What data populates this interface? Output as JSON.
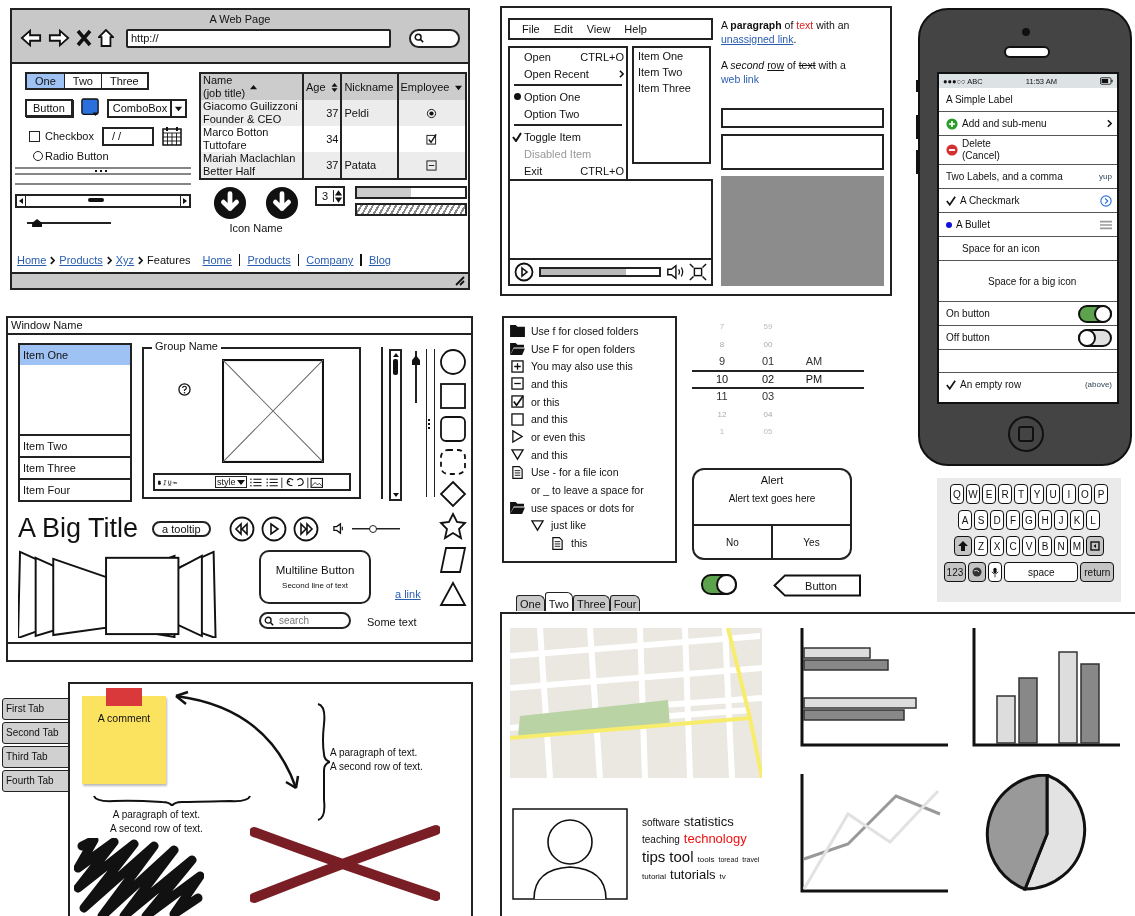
{
  "browser": {
    "title": "A Web Page",
    "url": "http://",
    "tabs": [
      {
        "label": "One",
        "selected": true
      },
      {
        "label": "Two",
        "selected": false
      },
      {
        "label": "Three",
        "selected": false
      }
    ],
    "button": "Button",
    "combobox": "ComboBox",
    "checkbox": {
      "label": "Checkbox",
      "checked": false
    },
    "date_field": "/ /",
    "radio": {
      "label": "Radio Button",
      "selected": false
    },
    "table": {
      "columns": [
        {
          "label": "Name",
          "sublabel": "(job title)",
          "kind": "ascending"
        },
        {
          "label": "Age",
          "kind": "both"
        },
        {
          "label": "Nickname",
          "kind": "plain"
        },
        {
          "label": "Employee",
          "kind": "menu"
        }
      ],
      "rows": [
        {
          "name": "Giacomo Guilizzoni",
          "job": "Founder & CEO",
          "age": "37",
          "nickname": "Peldi",
          "employee": {
            "kind": "radio",
            "on": true
          }
        },
        {
          "name": "Marco Botton",
          "job": "Tuttofare",
          "age": "34",
          "employee": {
            "kind": "checkbox",
            "on": true
          }
        },
        {
          "name": "Mariah Maclachlan",
          "job": "Better Half",
          "age": "37",
          "nickname": "Patata",
          "employee": {
            "kind": "collapse",
            "on": false
          }
        }
      ]
    },
    "slider": {
      "level": 0.12
    },
    "icon_label": "Icon Name",
    "stepper": "3",
    "progress": {
      "level": 0.5
    },
    "breadcrumbs": [
      {
        "label": "Home",
        "kind": "link"
      },
      {
        "label": "Products",
        "kind": "link"
      },
      {
        "label": "Xyz",
        "kind": "link"
      },
      {
        "label": "Features",
        "kind": "current"
      }
    ],
    "links": [
      "Home",
      "Products",
      "Company",
      "Blog"
    ]
  },
  "app": {
    "menubar": [
      "File",
      "Edit",
      "View",
      "Help"
    ],
    "menu": [
      {
        "kind": "item",
        "label": "Open",
        "shortcut": "CTRL+O",
        "disabled": false
      },
      {
        "kind": "submenu",
        "label": "Open Recent",
        "disabled": false
      },
      {
        "kind": "separator"
      },
      {
        "kind": "radio",
        "label": "Option One",
        "selected": true,
        "disabled": false
      },
      {
        "kind": "radio",
        "label": "Option Two",
        "selected": false,
        "disabled": false
      },
      {
        "kind": "separator"
      },
      {
        "kind": "toggle",
        "label": "Toggle Item",
        "checked": true,
        "disabled": false
      },
      {
        "kind": "item",
        "label": "Disabled Item",
        "disabled": true
      },
      {
        "kind": "item",
        "label": "Exit",
        "shortcut": "CTRL+O",
        "disabled": false
      }
    ],
    "list": [
      "Item One",
      "Item Two",
      "Item Three"
    ],
    "paragraph_1": [
      {
        "kind": "plain",
        "text": "A "
      },
      {
        "kind": "bold",
        "text": "paragraph"
      },
      {
        "kind": "plain",
        "text": " of "
      },
      {
        "kind": "red",
        "text": "text"
      },
      {
        "kind": "plain",
        "text": " with an "
      },
      {
        "kind": "link",
        "text": "unassigned link"
      },
      {
        "kind": "plain",
        "text": "."
      }
    ],
    "paragraph_2": [
      {
        "kind": "plain",
        "text": "A "
      },
      {
        "kind": "italic",
        "text": "second "
      },
      {
        "kind": "underline",
        "text": "row"
      },
      {
        "kind": "plain",
        "text": " of "
      },
      {
        "kind": "strike",
        "text": "text"
      },
      {
        "kind": "plain",
        "text": " with a "
      },
      {
        "kind": "link",
        "text": "web link"
      }
    ],
    "video": {
      "level": 0.72
    }
  },
  "phone": {
    "carrier": "●●●○○ ABC",
    "time": "11:53 AM",
    "rows": [
      {
        "kind": "label",
        "label": "A Simple Label"
      },
      {
        "kind": "add",
        "label": "Add and sub-menu"
      },
      {
        "kind": "delete",
        "label": "Delete",
        "sublabel": "(Cancel)"
      },
      {
        "kind": "detail",
        "label": "Two Labels, and a comma",
        "detail": "yup"
      },
      {
        "kind": "check",
        "label": "A Checkmark"
      },
      {
        "kind": "bullet",
        "label": "A Bullet"
      },
      {
        "kind": "indent",
        "label": "Space for an icon"
      },
      {
        "kind": "big-indent",
        "label": "Space for a big icon"
      },
      {
        "kind": "switch",
        "label": "On button",
        "on": true
      },
      {
        "kind": "switch",
        "label": "Off button",
        "on": false
      },
      {
        "kind": "empty"
      },
      {
        "kind": "check-detail",
        "label": "An empty row",
        "detail": "(above)"
      }
    ]
  },
  "keyboard": {
    "rows": [
      [
        "Q",
        "W",
        "E",
        "R",
        "T",
        "Y",
        "U",
        "I",
        "O",
        "P"
      ],
      [
        "A",
        "S",
        "D",
        "F",
        "G",
        "H",
        "J",
        "K",
        "L"
      ],
      [
        "Z",
        "X",
        "C",
        "V",
        "B",
        "N",
        "M"
      ]
    ],
    "numbers": "123",
    "space": "space",
    "return": "return"
  },
  "window": {
    "title": "Window Name",
    "list": [
      {
        "label": "Item One",
        "selected": true
      },
      {
        "label": "Item Two",
        "selected": false
      },
      {
        "label": "Item Three",
        "selected": false
      },
      {
        "label": "Item Four",
        "selected": false
      }
    ],
    "group": "Group Name",
    "style_menu": "style",
    "vertical_slider": {
      "level": 0.88
    },
    "big_title": "A Big Title",
    "tooltip": "a tooltip",
    "volume": {
      "level": 0.45
    },
    "multiline_button": {
      "label": "Multiline Button",
      "sublabel": "Second line of text"
    },
    "link": "a link",
    "search": {
      "placeholder": "search"
    },
    "text": "Some text"
  },
  "tree": [
    {
      "kind": "folder",
      "label": "Use f for closed folders"
    },
    {
      "kind": "open",
      "label": "Use F for open folders"
    },
    {
      "kind": "plus",
      "label": "You may also use this"
    },
    {
      "kind": "minus",
      "label": "and this"
    },
    {
      "kind": "checked",
      "label": "or this"
    },
    {
      "kind": "unchecked",
      "label": "and this"
    },
    {
      "kind": "collapsed",
      "label": "or even this"
    },
    {
      "kind": "expanded",
      "label": "and this"
    },
    {
      "kind": "file",
      "label": "Use - for a file icon"
    },
    {
      "kind": "blank",
      "label": "or _ to leave a space for"
    },
    {
      "kind": "open",
      "label": "use spaces or dots for",
      "children": [
        {
          "kind": "expanded",
          "label": "just like",
          "children": [
            {
              "kind": "file",
              "label": "this"
            }
          ]
        }
      ]
    }
  ],
  "time_picker": {
    "columns": [
      [
        {
          "label": "7",
          "selected": false
        },
        {
          "label": "8",
          "selected": false
        },
        {
          "label": "9",
          "selected": false
        },
        {
          "label": "10",
          "selected": true
        },
        {
          "label": "11",
          "selected": false
        },
        {
          "label": "12",
          "selected": false
        },
        {
          "label": "1",
          "selected": false
        }
      ],
      [
        {
          "label": "59",
          "selected": false
        },
        {
          "label": "00",
          "selected": false
        },
        {
          "label": "01",
          "selected": false
        },
        {
          "label": "02",
          "selected": true
        },
        {
          "label": "03",
          "selected": false
        },
        {
          "label": "04",
          "selected": false
        },
        {
          "label": "05",
          "selected": false
        }
      ],
      [
        {
          "label": "AM",
          "selected": false
        },
        {
          "label": "PM",
          "selected": true
        }
      ]
    ]
  },
  "alert": {
    "title": "Alert",
    "text": "Alert text goes here",
    "buttons": [
      "No",
      "Yes"
    ]
  },
  "switch": {
    "on": true
  },
  "back_button": "Button",
  "tabs": [
    {
      "label": "One",
      "selected": false
    },
    {
      "label": "Two",
      "selected": true
    },
    {
      "label": "Three",
      "selected": false
    },
    {
      "label": "Four",
      "selected": false
    }
  ],
  "tag_cloud": [
    {
      "text": "software",
      "kind": "s"
    },
    {
      "text": "statistics",
      "kind": "m"
    },
    {
      "text": "teaching",
      "kind": "s"
    },
    {
      "text": "technology",
      "kind": "hot"
    },
    {
      "text": "tips",
      "kind": "l"
    },
    {
      "text": "tool",
      "kind": "l"
    },
    {
      "text": "tools",
      "kind": "xs"
    },
    {
      "text": "toread",
      "kind": "xxs"
    },
    {
      "text": "travel",
      "kind": "xxs"
    },
    {
      "text": "tutorial",
      "kind": "xs"
    },
    {
      "text": "tutorials",
      "kind": "m"
    },
    {
      "text": "tv",
      "kind": "xs"
    }
  ],
  "side_tabs": [
    {
      "label": "First Tab",
      "selected": false
    },
    {
      "label": "Second Tab",
      "selected": false
    },
    {
      "label": "Third Tab",
      "selected": false
    },
    {
      "label": "Fourth Tab",
      "selected": false
    }
  ],
  "canvas": {
    "comment": "A comment",
    "brace_text_1": "A paragraph of text.\nA second row of text.",
    "brace_text_2": "A paragraph of text.\nA second row of text."
  }
}
